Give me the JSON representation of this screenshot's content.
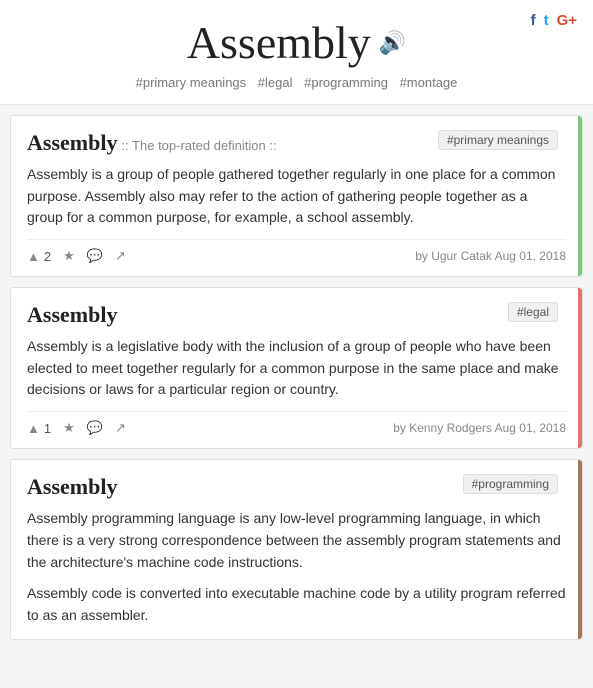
{
  "header": {
    "title": "Assembly",
    "speaker_icon": "🔊",
    "tags": [
      "#primary meanings",
      "#legal",
      "#programming",
      "#montage"
    ],
    "social": [
      {
        "label": "f",
        "class": "fb"
      },
      {
        "label": "t",
        "class": "tw"
      },
      {
        "label": "G+",
        "class": "gp"
      }
    ]
  },
  "cards": [
    {
      "id": "card-1",
      "title": "Assembly",
      "subtitle": ":: The top-rated definition ::",
      "tag": "#primary meanings",
      "accent_class": "accent-green",
      "body": "Assembly is a group of people gathered together regularly in one place for a common purpose. Assembly also may refer to the action of gathering people together as a group for a common purpose, for example, a school assembly.",
      "body2": null,
      "votes": "2",
      "author": "Ugur Catak",
      "date": "Aug 01, 2018"
    },
    {
      "id": "card-2",
      "title": "Assembly",
      "subtitle": null,
      "tag": "#legal",
      "accent_class": "accent-red",
      "body": "Assembly is a legislative body with the inclusion of a group of people who have been elected to meet together regularly for a common purpose in the same place and make decisions or laws for a particular region or country.",
      "body2": null,
      "votes": "1",
      "author": "Kenny Rodgers",
      "date": "Aug 01, 2018"
    },
    {
      "id": "card-3",
      "title": "Assembly",
      "subtitle": null,
      "tag": "#programming",
      "accent_class": "accent-brown",
      "body": "Assembly programming language is any low-level programming language, in which there is a very strong correspondence between the assembly program statements and the architecture's machine code instructions.",
      "body2": "Assembly code is converted into executable machine code by a utility program referred to as an assembler.",
      "votes": null,
      "author": null,
      "date": null
    }
  ],
  "labels": {
    "vote_up": "▲",
    "star": "★",
    "comment": "💬",
    "share": "↗",
    "by": "by"
  }
}
